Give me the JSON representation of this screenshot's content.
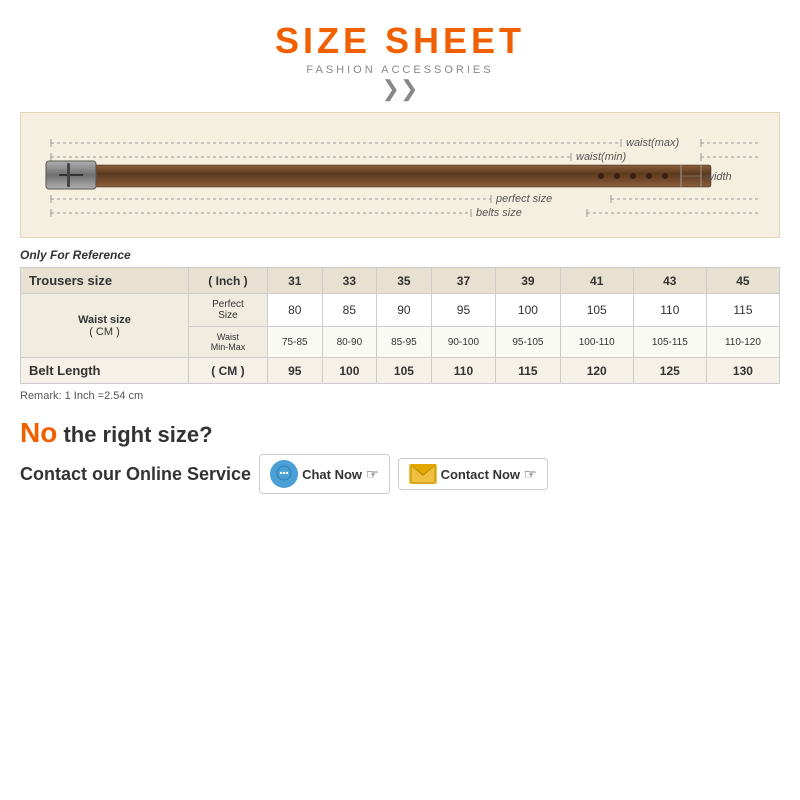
{
  "title": {
    "main": "SIZE SHEET",
    "subtitle": "FASHION ACCESSORIES",
    "chevron": "❮❮"
  },
  "belt_diagram": {
    "labels": {
      "waist_max": "waist(max)",
      "waist_min": "waist(min)",
      "perfect_size": "perfect size",
      "belts_size": "belts size",
      "width": "width"
    }
  },
  "reference_label": "Only For Reference",
  "table": {
    "headers": {
      "trousers_size": "Trousers size",
      "inch": "( Inch )",
      "waist_size": "Waist size",
      "cm": "( CM )",
      "belt_length": "Belt Length",
      "belt_cm": "( CM )"
    },
    "sizes": [
      "31",
      "33",
      "35",
      "37",
      "39",
      "41",
      "43",
      "45"
    ],
    "perfect": [
      "80",
      "85",
      "90",
      "95",
      "100",
      "105",
      "110",
      "115"
    ],
    "waist_min_max_label": "Waist Min-Max",
    "perfect_size_label": "Perfect Size",
    "waist_minmax": [
      "75-85",
      "80-90",
      "85-95",
      "90-100",
      "95-105",
      "100-110",
      "105-115",
      "110-120"
    ],
    "belt_lengths": [
      "95",
      "100",
      "105",
      "110",
      "115",
      "120",
      "125",
      "130"
    ]
  },
  "remark": "Remark: 1 Inch =2.54 cm",
  "no_size": {
    "no": "No",
    "text": " the right size?"
  },
  "contact": {
    "label": "Contact our Online Service",
    "chat_btn": "Chat Now",
    "contact_btn": "Contact Now"
  }
}
